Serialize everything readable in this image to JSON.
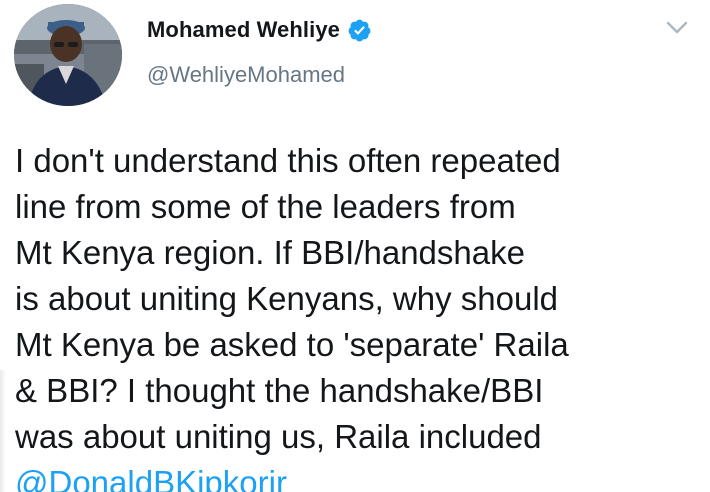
{
  "author": {
    "display_name": "Mohamed Wehliye",
    "handle": "@WehliyeMohamed",
    "avatar_icon": "profile-photo",
    "verified_icon": "verified-badge-icon",
    "verified_color": "#1da1f2"
  },
  "menu": {
    "icon": "chevron-down-icon"
  },
  "tweet": {
    "lines": [
      "I don't understand this often repeated",
      "line from some of the leaders from",
      "Mt Kenya region. If BBI/handshake",
      "is about uniting Kenyans, why should",
      "Mt Kenya be asked to 'separate' Raila",
      "& BBI? I thought the handshake/BBI",
      "was about uniting us, Raila included"
    ],
    "mention": "@DonaldBKipkorir"
  },
  "colors": {
    "text": "#14171a",
    "secondary": "#657786",
    "link": "#1da1f2"
  }
}
